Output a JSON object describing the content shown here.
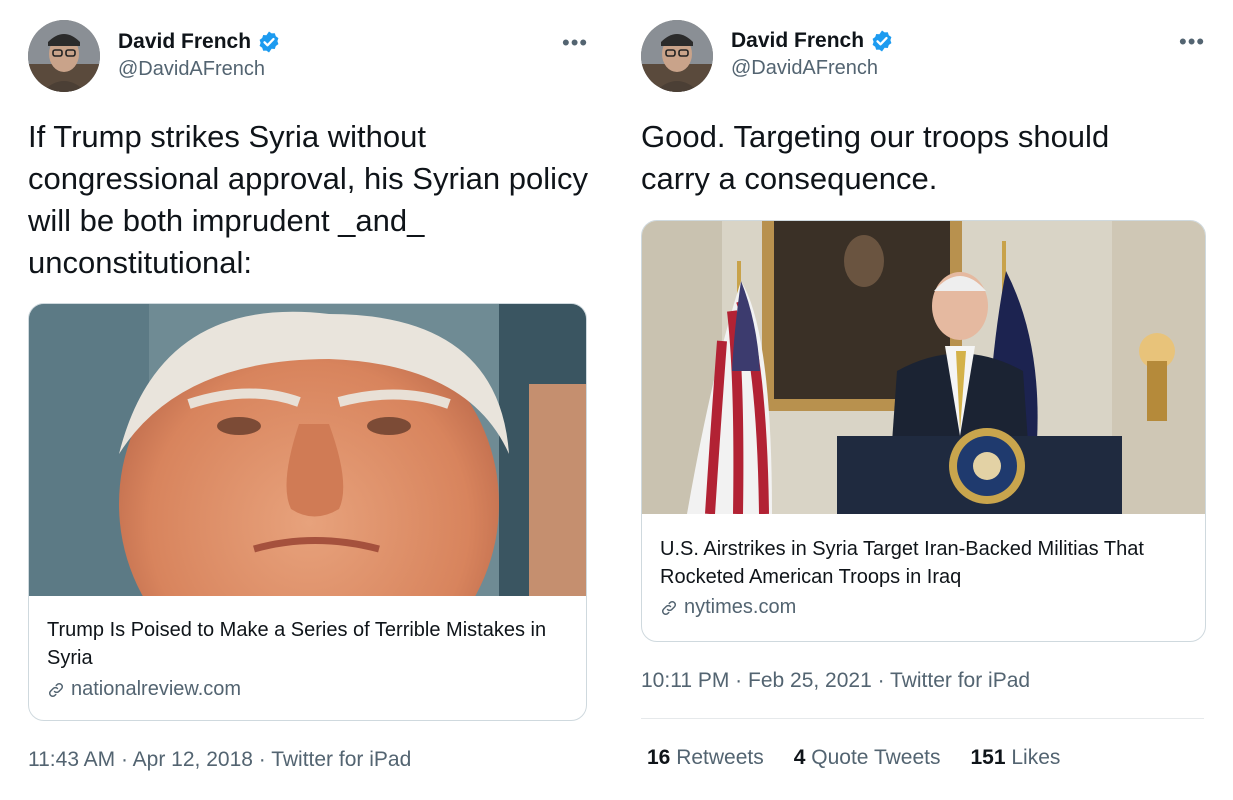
{
  "left": {
    "author_name": "David French",
    "author_handle": "@DavidAFrench",
    "more_label": "•••",
    "text": "If Trump strikes Syria without congressional approval, his Syrian policy will be both imprudent _and_ unconstitutional:",
    "card": {
      "title": "Trump Is Poised to Make a Series of Terrible Mistakes in Syria",
      "domain": "nationalreview.com"
    },
    "meta": "11:43 AM · Apr 12, 2018 · Twitter for iPad"
  },
  "right": {
    "author_name": "David French",
    "author_handle": "@DavidAFrench",
    "more_label": "•••",
    "text": "Good. Targeting our troops should carry a consequence.",
    "card": {
      "title": "U.S. Airstrikes in Syria Target Iran-Backed Militias That Rocketed American Troops in Iraq",
      "domain": "nytimes.com"
    },
    "meta": "10:11 PM · Feb 25, 2021 · Twitter for iPad",
    "stats": {
      "retweets_count": "16",
      "retweets_label": "Retweets",
      "quotes_count": "4",
      "quotes_label": "Quote Tweets",
      "likes_count": "151",
      "likes_label": "Likes"
    }
  },
  "colors": {
    "verified_blue": "#1d9bf0",
    "text_primary": "#0f1419",
    "text_secondary": "#536471",
    "border": "#cfd9de"
  }
}
